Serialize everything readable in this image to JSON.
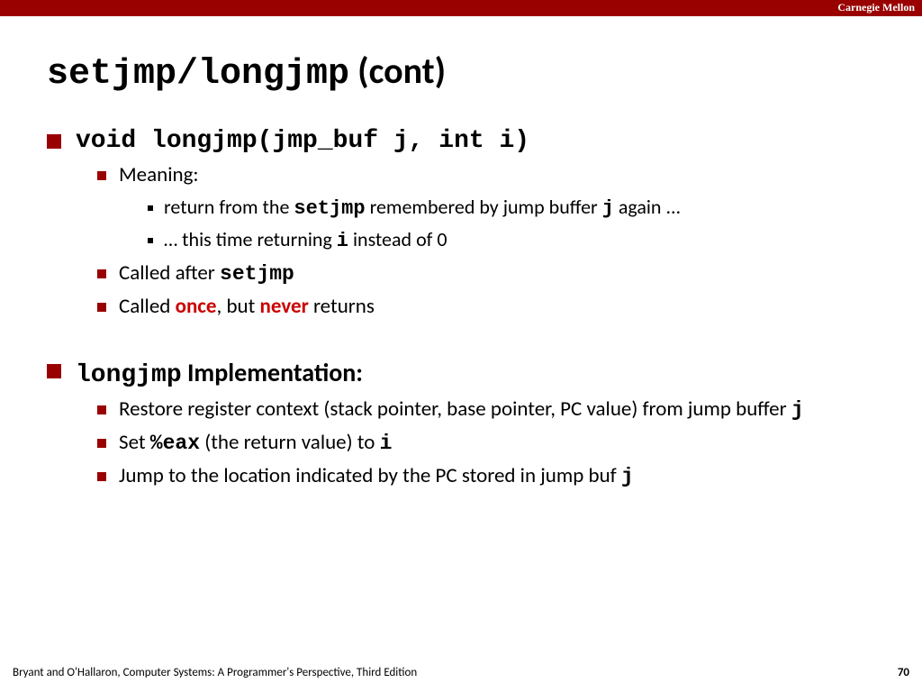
{
  "header": {
    "brand": "Carnegie Mellon"
  },
  "title": {
    "mono": "setjmp/longjmp",
    "rest": " (cont)"
  },
  "bullets": {
    "b1": {
      "mono": "void longjmp(jmp_buf j, int i)",
      "meaning_label": "Meaning:",
      "m1_a": "return from the ",
      "m1_b": "setjmp",
      "m1_c": " remembered by jump buffer ",
      "m1_d": "j",
      "m1_e": " again ...",
      "m2_a": "… this time returning  ",
      "m2_b": "i",
      "m2_c": " instead of 0",
      "called_after_a": "Called after ",
      "called_after_b": "setjmp",
      "called_once_a": "Called ",
      "called_once_b": "once",
      "called_once_c": ", but ",
      "called_once_d": "never",
      "called_once_e": " returns"
    },
    "b2": {
      "head_mono": "longjmp",
      "head_rest": " Implementation:",
      "i1_a": "Restore register context (stack pointer, base pointer, PC value) from jump buffer ",
      "i1_b": "j",
      "i2_a": "Set ",
      "i2_b": "%eax",
      "i2_c": " (the return value) to ",
      "i2_d": "i",
      "i3_a": "Jump to the location indicated by the PC stored in jump buf ",
      "i3_b": "j"
    }
  },
  "footer": {
    "citation": "Bryant and O'Hallaron, Computer Systems: A Programmer's Perspective, Third Edition",
    "page": "70"
  }
}
